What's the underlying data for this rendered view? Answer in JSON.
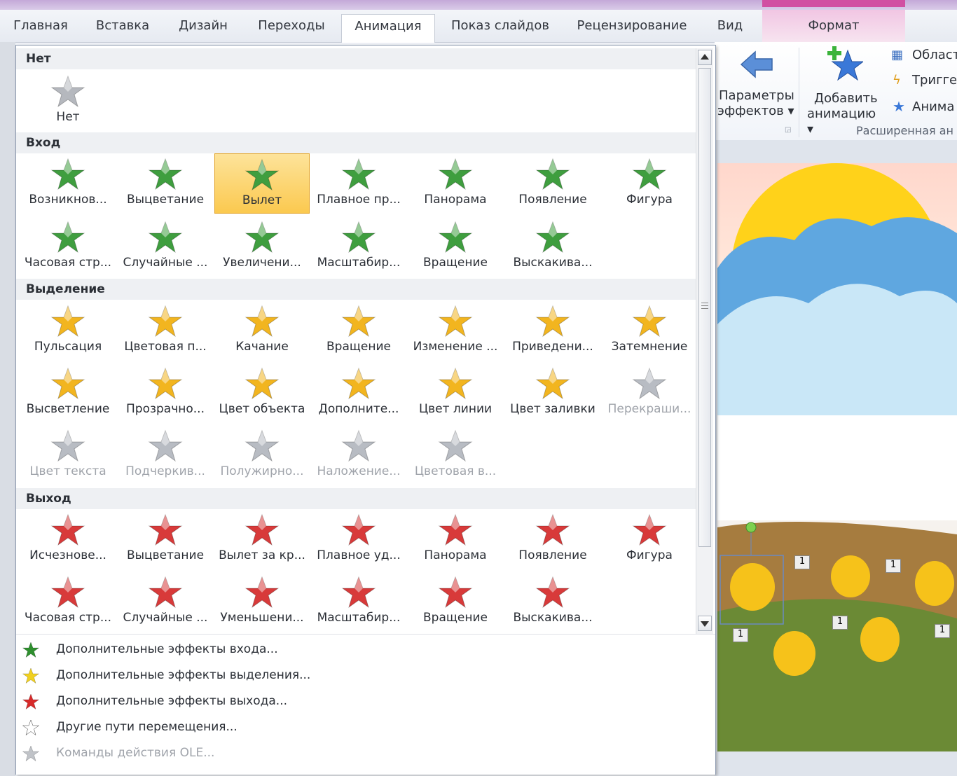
{
  "tabs": [
    "Главная",
    "Вставка",
    "Дизайн",
    "Переходы",
    "Анимация",
    "Показ слайдов",
    "Рецензирование",
    "Вид",
    "Формат"
  ],
  "ribbon": {
    "effect_params_line1": "Параметры",
    "effect_params_line2": "эффектов",
    "add_anim_line1": "Добавить",
    "add_anim_line2": "анимацию",
    "area": "Област",
    "trigger": "Тригге",
    "animator": "Анима",
    "group_label": "Расширенная ан"
  },
  "gallery": {
    "none": {
      "header": "Нет",
      "items": [
        {
          "label": "Нет"
        }
      ]
    },
    "entrance": {
      "header": "Вход",
      "items": [
        "Возникнов...",
        "Выцветание",
        "Вылет",
        "Плавное пр...",
        "Панорама",
        "Появление",
        "Фигура",
        "Часовая стр...",
        "Случайные ...",
        "Увеличени...",
        "Масштабир...",
        "Вращение",
        "Выскакива..."
      ],
      "selected": "Вылет"
    },
    "emphasis": {
      "header": "Выделение",
      "items": [
        "Пульсация",
        "Цветовая п...",
        "Качание",
        "Вращение",
        "Изменение ...",
        "Приведени...",
        "Затемнение",
        "Высветление",
        "Прозрачно...",
        "Цвет объекта",
        "Дополните...",
        "Цвет линии",
        "Цвет заливки",
        "Перекраши...",
        "Цвет текста",
        "Подчеркив...",
        "Полужирно...",
        "Наложение...",
        "Цветовая в..."
      ],
      "disabled": [
        "Перекраши...",
        "Цвет текста",
        "Подчеркив...",
        "Полужирно...",
        "Наложение...",
        "Цветовая в..."
      ]
    },
    "exit": {
      "header": "Выход",
      "items": [
        "Исчезнове...",
        "Выцветание",
        "Вылет за кр...",
        "Плавное уд...",
        "Панорама",
        "Появление",
        "Фигура",
        "Часовая стр...",
        "Случайные ...",
        "Уменьшени...",
        "Масштабир...",
        "Вращение",
        "Выскакива..."
      ]
    }
  },
  "menu": [
    {
      "label": "Дополнительные эффекты входа...",
      "icon": "green-star-icon"
    },
    {
      "label": "Дополнительные эффекты выделения...",
      "icon": "yellow-star-icon"
    },
    {
      "label": "Дополнительные эффекты выхода...",
      "icon": "red-star-icon"
    },
    {
      "label": "Другие пути перемещения...",
      "icon": "outline-star-icon"
    },
    {
      "label": "Команды действия OLE...",
      "icon": "ole-icon",
      "disabled": true
    }
  ],
  "slide": {
    "badge": "1"
  },
  "colors": {
    "entrance": "#3f9e3f",
    "emphasis": "#f2b51f",
    "exit": "#d83a3a",
    "disabled": "#b8bcc3",
    "selected": "#fbc94f"
  }
}
